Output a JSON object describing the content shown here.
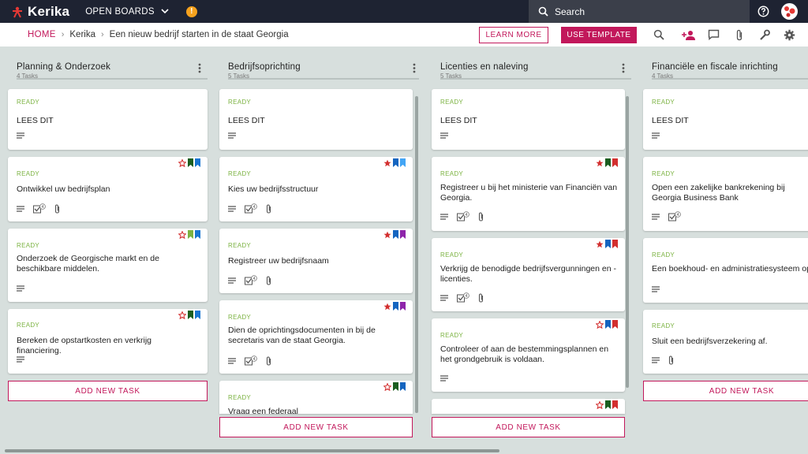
{
  "app": {
    "name": "Kerika",
    "open_boards": "OPEN BOARDS",
    "alert_badge": "!",
    "search_placeholder": "Search"
  },
  "breadcrumb": {
    "home": "HOME",
    "items": [
      "Kerika",
      "Een nieuw bedrijf starten in de staat Georgia"
    ]
  },
  "toolbar": {
    "learn_more": "LEARN MORE",
    "use_template": "USE TEMPLATE"
  },
  "colors": {
    "accent": "#c2185b",
    "status": "#7cb342",
    "topbar": "#1e2332"
  },
  "columns": [
    {
      "title": "Planning & Onderzoek",
      "count": "4 Tasks",
      "add": "ADD NEW TASK",
      "cards": [
        {
          "status": "READY",
          "title": "LEES DIT"
        },
        {
          "status": "READY",
          "title": "Ontwikkel uw bedrijfsplan",
          "checklist": "4"
        },
        {
          "status": "READY",
          "title": "Onderzoek de Georgische markt en de beschikbare middelen."
        },
        {
          "status": "READY",
          "title": "Bereken de opstartkosten en verkrijg financiering."
        }
      ]
    },
    {
      "title": "Bedrijfsoprichting",
      "count": "5 Tasks",
      "add": "ADD NEW TASK",
      "cards": [
        {
          "status": "READY",
          "title": "LEES DIT"
        },
        {
          "status": "READY",
          "title": "Kies uw bedrijfsstructuur",
          "checklist": "4"
        },
        {
          "status": "READY",
          "title": "Registreer uw bedrijfsnaam",
          "checklist": "4"
        },
        {
          "status": "READY",
          "title": "Dien de oprichtingsdocumenten in bij de secretaris van de staat Georgia.",
          "checklist": "4"
        },
        {
          "status": "READY",
          "title": "Vraag een federaal"
        }
      ]
    },
    {
      "title": "Licenties en naleving",
      "count": "5 Tasks",
      "add": "ADD NEW TASK",
      "cards": [
        {
          "status": "READY",
          "title": "LEES DIT"
        },
        {
          "status": "READY",
          "title": "Registreer u bij het ministerie van Financiën van Georgia.",
          "checklist": "4"
        },
        {
          "status": "READY",
          "title": "Verkrijg de benodigde bedrijfsvergunningen en -licenties.",
          "checklist": "4"
        },
        {
          "status": "READY",
          "title": "Controleer of aan de bestemmingsplannen en het grondgebruik is voldaan."
        }
      ]
    },
    {
      "title": "Financiële en fiscale inrichting",
      "count": "4 Tasks",
      "add": "ADD NEW TASK",
      "cards": [
        {
          "status": "READY",
          "title": "LEES DIT"
        },
        {
          "status": "READY",
          "title": "Open een zakelijke bankrekening bij Georgia Business Bank",
          "checklist": "4"
        },
        {
          "status": "READY",
          "title": "Een boekhoud- en administratiesysteem op"
        },
        {
          "status": "READY",
          "title": "Sluit een bedrijfsverzekering af."
        }
      ]
    }
  ]
}
